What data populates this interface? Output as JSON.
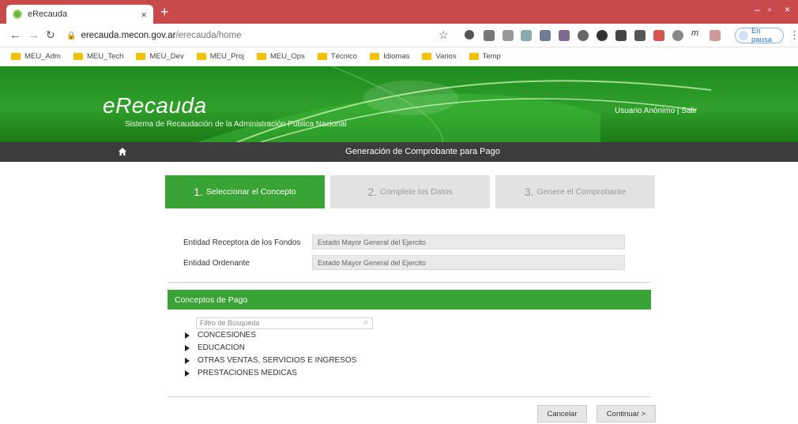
{
  "browser": {
    "tab_title": "eRecauda",
    "tab_close": "×",
    "new_tab": "+",
    "url_host": "erecauda.mecon.gov.ar",
    "url_path": "/erecauda/home",
    "profile_status": "En pausa",
    "bookmarks": [
      "MEU_Adm",
      "MEU_Tech",
      "MEU_Dev",
      "MEU_Proj",
      "MEU_Ops",
      "Técnico",
      "Idiomas",
      "Varios",
      "Temp"
    ]
  },
  "site": {
    "logo": "eRecauda",
    "subtitle": "Sistema de Recaudación de la Administración Pública Nacional",
    "user_links": "Usuario Anónimo | Salir",
    "page_title": "Generación de Comprobante para Pago"
  },
  "steps": [
    {
      "num": "1.",
      "label": "Seleccionar el Concepto"
    },
    {
      "num": "2.",
      "label": "Complete los Datos"
    },
    {
      "num": "3.",
      "label": "Genere el Comprobante"
    }
  ],
  "fields": {
    "receptora_label": "Entidad Receptora de los Fondos",
    "receptora_value": "Estado Mayor General del Ejercito",
    "ordenante_label": "Entidad Ordenante",
    "ordenante_value": "Estado Mayor General del Ejercito"
  },
  "conceptos": {
    "title": "Conceptos de Pago",
    "filter_placeholder": "Filtro de Búsqueda",
    "items": [
      "CONCESIONES",
      "EDUCACION",
      "OTRAS VENTAS, SERVICIOS E INGRESOS",
      "PRESTACIONES MEDICAS"
    ]
  },
  "actions": {
    "cancel": "Cancelar",
    "continue": "Continuar >"
  },
  "colors": {
    "brand_green": "#3aa335",
    "tabstrip_red": "#c94a4a",
    "dark_bar": "#3d3d3d"
  }
}
